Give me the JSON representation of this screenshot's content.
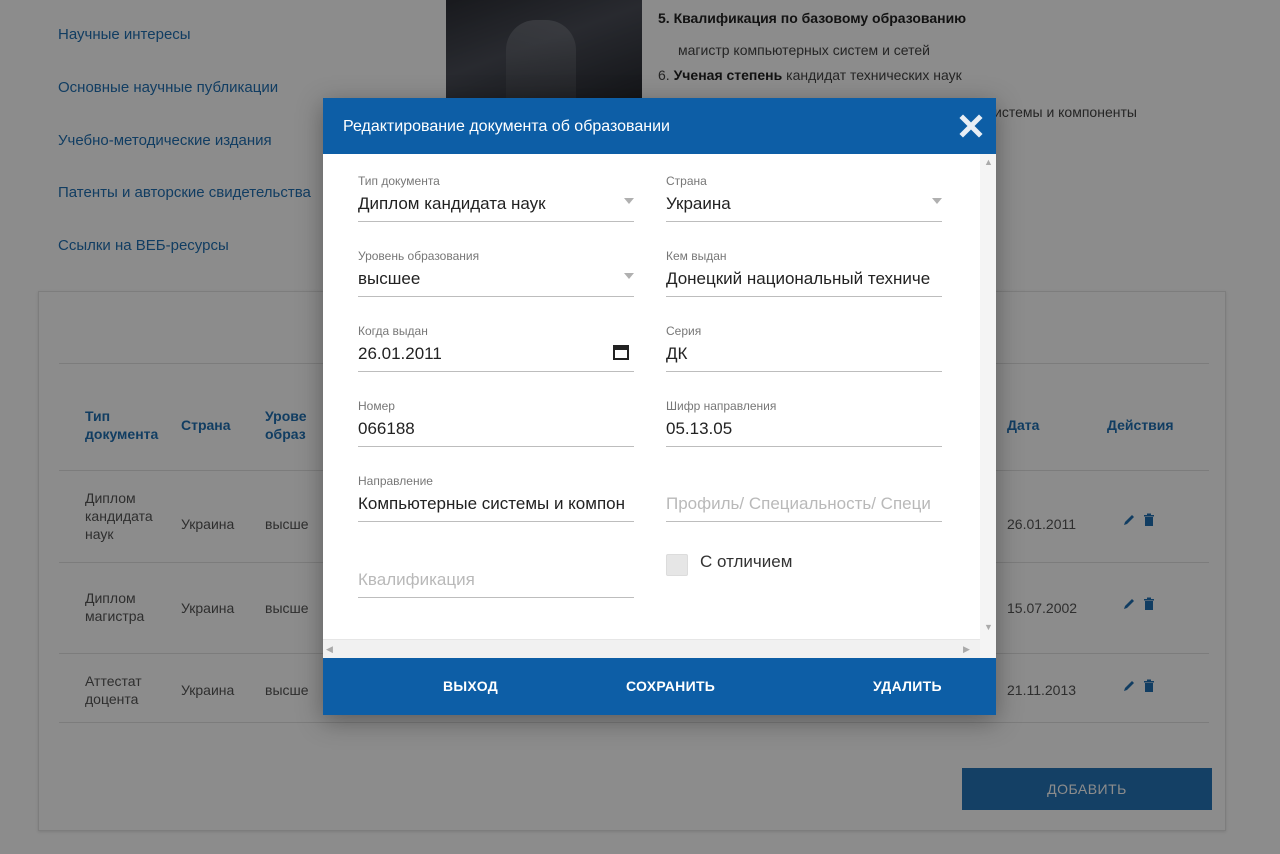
{
  "sidebar": {
    "links": [
      "Научные интересы",
      "Основные научные публикации",
      "Учебно-методические издания",
      "Патенты и авторские свидетельства",
      "Ссылки на ВЕБ-ресурсы"
    ]
  },
  "profile": {
    "item5_label": "5. Квалификация по базовому образованию",
    "item5_value": "магистр компьютерных систем и сетей",
    "item6_prefix": "6. ",
    "item6_label": "Ученая степень",
    "item6_value": " кандидат технических наук",
    "item7_partial": "истемы и компоненты"
  },
  "table": {
    "headers": {
      "type": [
        "Тип",
        "документа"
      ],
      "country": "Страна",
      "level": [
        "Урове",
        "образ"
      ],
      "date": "Дата",
      "actions": "Действия"
    },
    "rows": [
      {
        "type": [
          "Диплом",
          "кандидата",
          "наук"
        ],
        "country": "Украина",
        "level": "высше",
        "date": "26.01.2011"
      },
      {
        "type": [
          "Диплом",
          "магистра"
        ],
        "country": "Украина",
        "level": "высше",
        "date": "15.07.2002"
      },
      {
        "type": [
          "Аттестат",
          "доцента"
        ],
        "country": "Украина",
        "level": "высше",
        "date": "21.11.2013"
      }
    ],
    "add_button": "ДОБАВИТЬ"
  },
  "modal": {
    "title": "Редактирование документа об образовании",
    "fields": {
      "doc_type": {
        "label": "Тип документа",
        "value": "Диплом кандидата наук"
      },
      "country": {
        "label": "Страна",
        "value": "Украина"
      },
      "edu_level": {
        "label": "Уровень образования",
        "value": "высшее"
      },
      "issued_by": {
        "label": "Кем выдан",
        "value": "Донецкий национальный техниче"
      },
      "issue_date": {
        "label": "Когда выдан",
        "value": "26.01.2011"
      },
      "series": {
        "label": "Серия",
        "value": "ДК"
      },
      "number": {
        "label": "Номер",
        "value": "066188"
      },
      "direction_code": {
        "label": "Шифр направления",
        "value": "05.13.05"
      },
      "direction": {
        "label": "Направление",
        "value": "Компьютерные системы и компон"
      },
      "profile": {
        "placeholder": "Профиль/ Специальность/ Специ"
      },
      "qualification": {
        "placeholder": "Квалификация"
      }
    },
    "honors_label": "С отличием",
    "honors_checked": false,
    "buttons": {
      "exit": "ВЫХОД",
      "save": "СОХРАНИТЬ",
      "delete": "УДАЛИТЬ"
    }
  },
  "colors": {
    "primary": "#0d5ea6",
    "link": "#1f6fb2"
  }
}
